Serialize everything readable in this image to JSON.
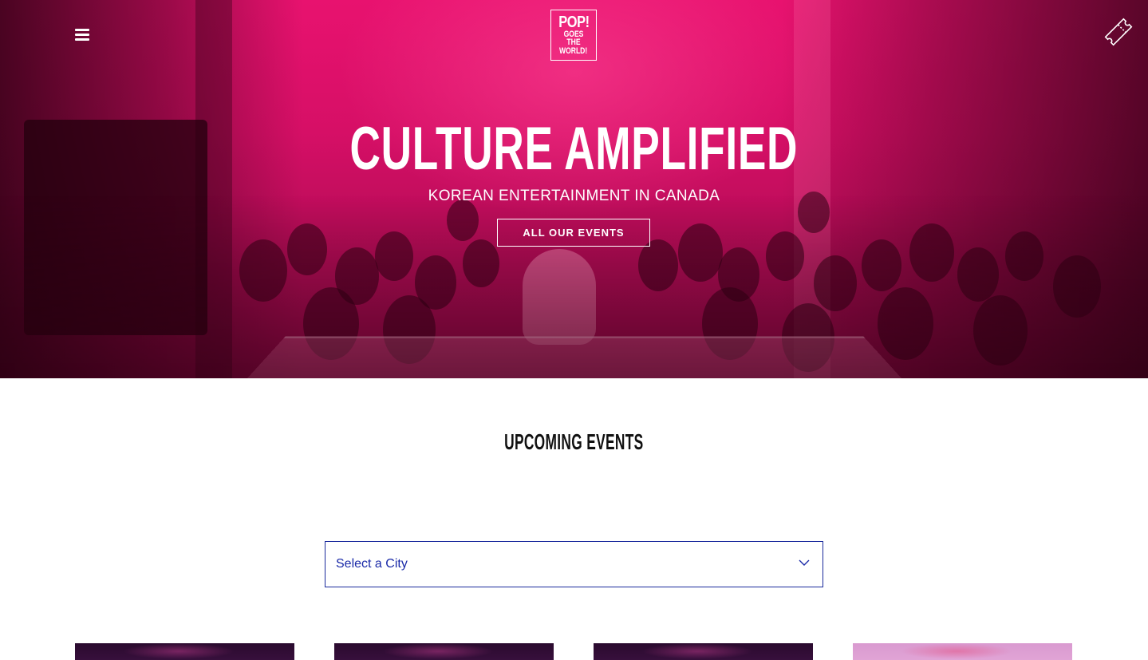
{
  "header": {
    "logo_line1": "POP!",
    "logo_line2": "GOES THE",
    "logo_line3": "WORLD!",
    "menu_icon": "hamburger-menu-icon",
    "ticket_icon": "ticket-icon"
  },
  "hero": {
    "title": "CULTURE AMPLIFIED",
    "subtitle": "KOREAN ENTERTAINMENT IN CANADA",
    "button_label": "ALL OUR EVENTS"
  },
  "events": {
    "section_title": "UPCOMING EVENTS",
    "city_select": {
      "selected": "Select a City",
      "chevron_icon": "chevron-down-icon"
    }
  },
  "colors": {
    "hero_pink": "#e8126f",
    "select_border": "#1a2a9c",
    "select_text": "#1a2aa8"
  }
}
